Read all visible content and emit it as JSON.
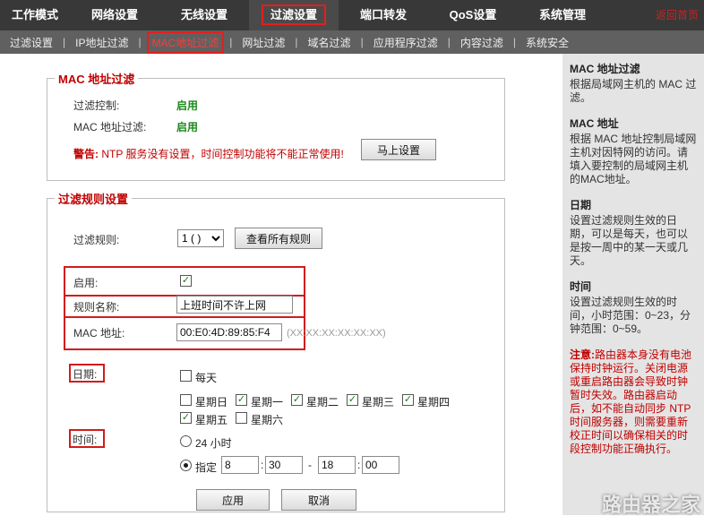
{
  "top_nav": {
    "items": [
      "工作模式",
      "网络设置",
      "无线设置",
      "过滤设置",
      "端口转发",
      "QoS设置",
      "系统管理"
    ],
    "active_index": 3,
    "home_link": "返回首页"
  },
  "sub_nav": {
    "items": [
      "过滤设置",
      "IP地址过滤",
      "MAC地址过滤",
      "网址过滤",
      "域名过滤",
      "应用程序过滤",
      "内容过滤",
      "系统安全"
    ],
    "active_index": 2
  },
  "mac_filter": {
    "legend": "MAC 地址过滤",
    "control_label": "过滤控制:",
    "control_value": "启用",
    "mac_label": "MAC 地址过滤:",
    "mac_value": "启用",
    "warning_prefix": "警告:",
    "warning_text": " NTP 服务没有设置，时间控制功能将不能正常使用!",
    "setup_button": "马上设置"
  },
  "rule_settings": {
    "legend": "过滤规则设置",
    "rule_label": "过滤规则:",
    "rule_select": "1 ( )",
    "view_all_button": "查看所有规则",
    "enable_label": "启用:",
    "enable_checked": true,
    "name_label": "规则名称:",
    "name_value": "上班时间不许上网",
    "mac_label": "MAC 地址:",
    "mac_value": "00:E0:4D:89:85:F4",
    "mac_hint": "(XX:XX:XX:XX:XX:XX)",
    "date_label": "日期:",
    "everyday_label": "每天",
    "everyday_checked": false,
    "days": [
      {
        "label": "星期日",
        "checked": false
      },
      {
        "label": "星期一",
        "checked": true
      },
      {
        "label": "星期二",
        "checked": true
      },
      {
        "label": "星期三",
        "checked": true
      },
      {
        "label": "星期四",
        "checked": true
      },
      {
        "label": "星期五",
        "checked": true
      },
      {
        "label": "星期六",
        "checked": false
      }
    ],
    "time_label": "时间:",
    "time_24h_label": "24 小时",
    "time_custom_label": "指定",
    "time_custom_selected": true,
    "start_hour": "8",
    "start_min": "30",
    "range_dash": "-",
    "time_colon": ":",
    "end_hour": "18",
    "end_min": "00",
    "apply_button": "应用",
    "cancel_button": "取消"
  },
  "sidebar": {
    "sec1_title": "MAC 地址过滤",
    "sec1_text": "根据局域网主机的 MAC 过滤。",
    "sec2_title": "MAC 地址",
    "sec2_text": "根据 MAC 地址控制局域网主机对因特网的访问。请填入要控制的局域网主机的MAC地址。",
    "sec3_title": "日期",
    "sec3_text": "设置过滤规则生效的日期，可以是每天，也可以是按一周中的某一天或几天。",
    "sec4_title": "时间",
    "sec4_text": "设置过滤规则生效的时间，小时范围：0~23，分钟范围：0~59。",
    "note_prefix": "注意:",
    "note_text": "路由器本身没有电池保持时钟运行。关闭电源或重启路由器会导致时钟暂时失效。路由器启动后，如不能自动同步 NTP 时间服务器，则需要重新校正时间以确保相关的时段控制功能正确执行。",
    "watermark": "路由器之家"
  },
  "colors": {
    "accent_red": "#c00000",
    "nav_dark": "#383838",
    "subnav": "#606060",
    "enabled_green": "#1a8a1a",
    "sidebar_bg": "#e4e4e4"
  }
}
